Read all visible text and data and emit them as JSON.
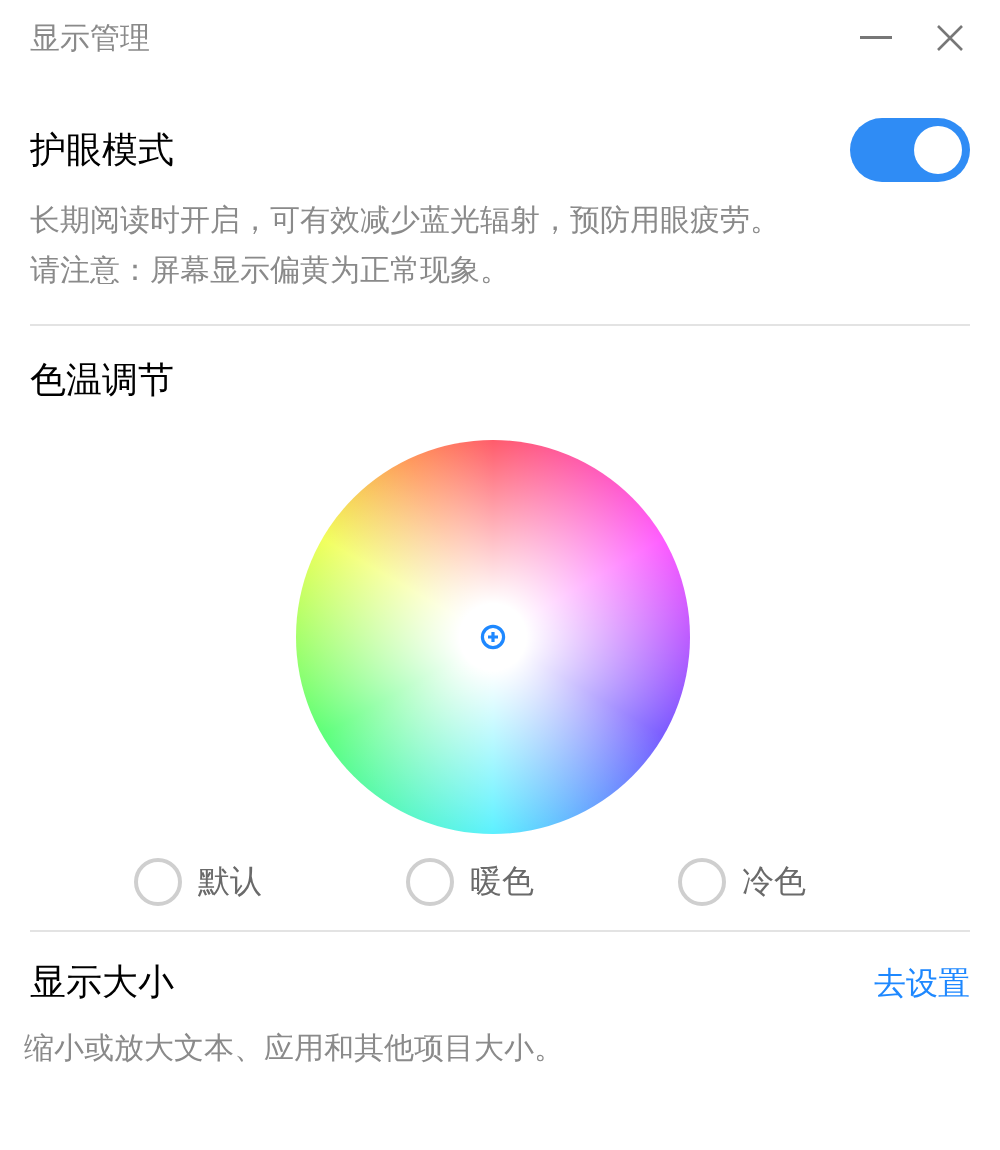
{
  "window": {
    "title": "显示管理"
  },
  "eye_care": {
    "title": "护眼模式",
    "on": true,
    "description": [
      "长期阅读时开启，可有效减少蓝光辐射，预防用眼疲劳。",
      "请注意：屏幕显示偏黄为正常现象。"
    ]
  },
  "color_temperature": {
    "title": "色温调节",
    "options": [
      {
        "label": "默认",
        "selected": false
      },
      {
        "label": "暖色",
        "selected": false
      },
      {
        "label": "冷色",
        "selected": false
      }
    ]
  },
  "display_size": {
    "title": "显示大小",
    "link": "去设置",
    "description": "缩小或放大文本、应用和其他项目大小。"
  }
}
